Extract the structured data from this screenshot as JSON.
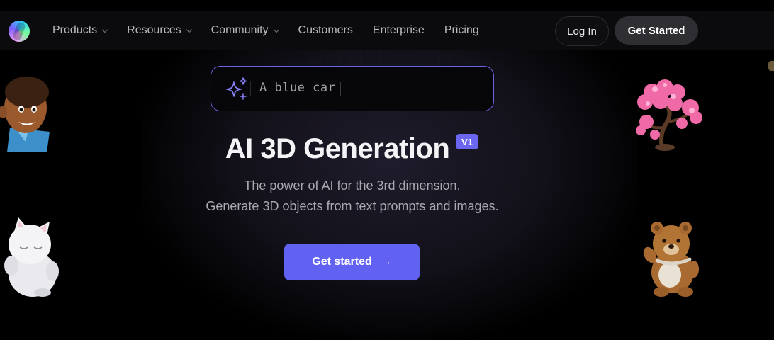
{
  "nav": {
    "items": [
      {
        "label": "Products",
        "dropdown": true
      },
      {
        "label": "Resources",
        "dropdown": true
      },
      {
        "label": "Community",
        "dropdown": true
      },
      {
        "label": "Customers",
        "dropdown": false
      },
      {
        "label": "Enterprise",
        "dropdown": false
      },
      {
        "label": "Pricing",
        "dropdown": false
      }
    ],
    "login_label": "Log In",
    "get_started_label": "Get Started"
  },
  "prompt": {
    "text": "A blue car",
    "icon": "sparkle-icon"
  },
  "hero": {
    "title": "AI 3D Generation",
    "badge": "V1",
    "subtitle_line1": "The power of AI for the 3rd dimension.",
    "subtitle_line2": "Generate 3D objects from text prompts and images.",
    "cta_label": "Get started",
    "cta_arrow": "→"
  },
  "colors": {
    "accent": "#6262f2",
    "prompt_border": "#6b63e6",
    "background": "#000000"
  },
  "decorations": [
    "boy-avatar-model",
    "white-cat-model",
    "cherry-blossom-tree-model",
    "teddy-bear-model"
  ]
}
